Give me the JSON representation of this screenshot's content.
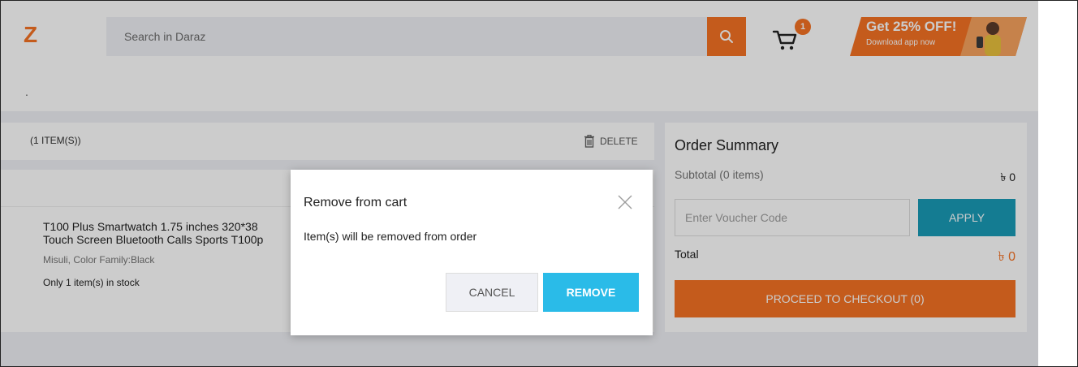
{
  "header": {
    "logo": "Z",
    "search_placeholder": "Search in Daraz",
    "cart_count": "1",
    "promo": {
      "title": "Get 25% OFF!",
      "subtitle": "Download app now"
    }
  },
  "breadcrumb": {
    "text": "."
  },
  "cart": {
    "items_count_label": "(1 ITEM(S))",
    "delete_label": "DELETE",
    "product": {
      "title_line1": "T100 Plus Smartwatch 1.75 inches 320*38",
      "title_line2": "Touch Screen Bluetooth Calls Sports T100p",
      "variant": "Misuli, Color Family:Black",
      "stock": "Only 1 item(s) in stock"
    }
  },
  "summary": {
    "title": "Order Summary",
    "subtotal_label": "Subtotal (0 items)",
    "subtotal_value": "৳ 0",
    "voucher_placeholder": "Enter Voucher Code",
    "apply_label": "APPLY",
    "total_label": "Total",
    "total_value": "৳ 0",
    "checkout_label": "PROCEED TO CHECKOUT (0)"
  },
  "modal": {
    "title": "Remove from cart",
    "message": "Item(s) will be removed from order",
    "cancel_label": "CANCEL",
    "remove_label": "REMOVE"
  },
  "colors": {
    "brand_orange": "#f57224",
    "apply_blue": "#1a9cb7",
    "remove_blue": "#2abbe8"
  }
}
